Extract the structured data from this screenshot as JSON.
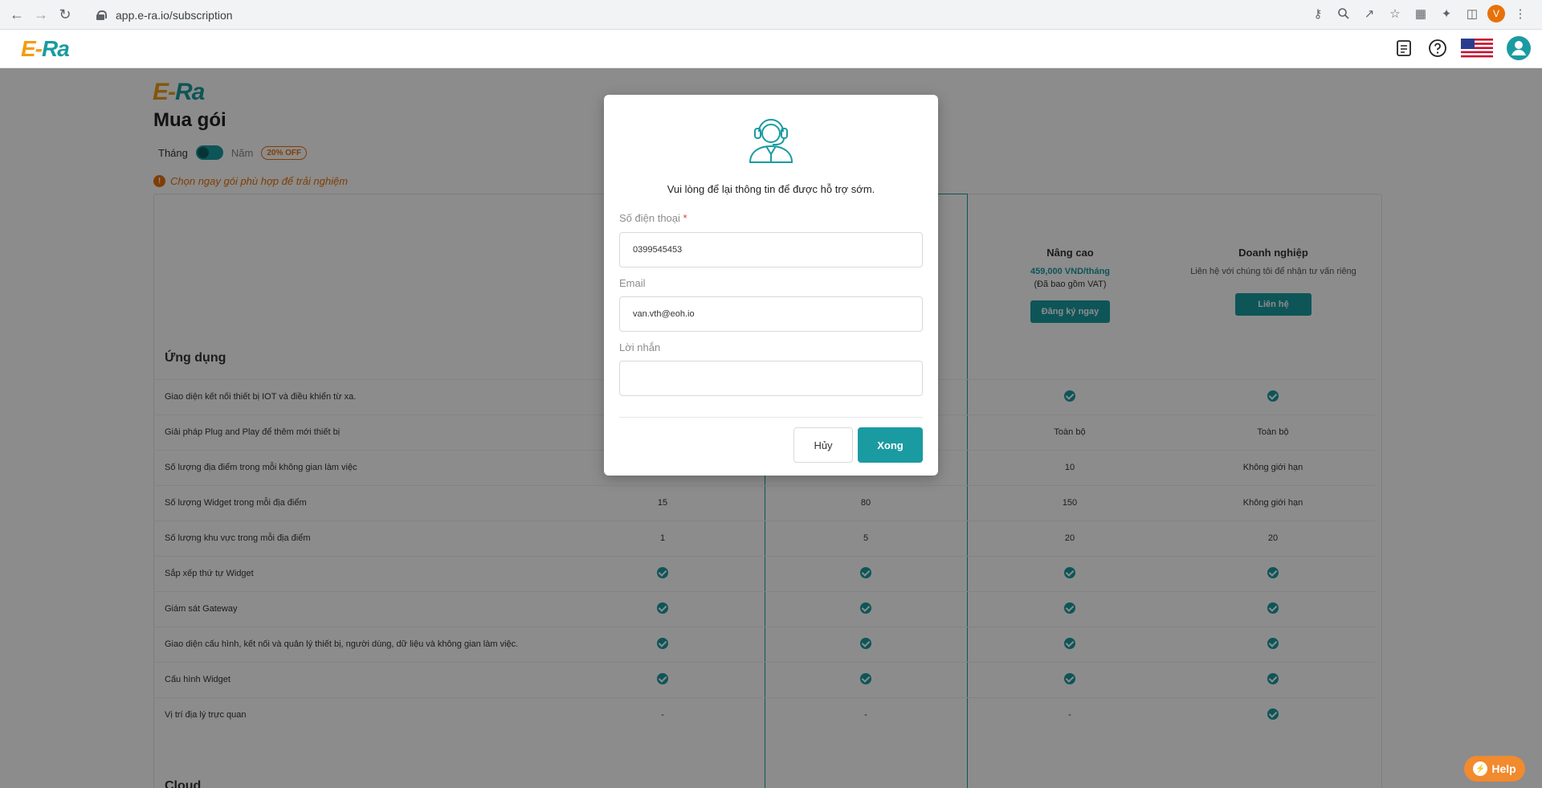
{
  "browser": {
    "url": "app.e-ra.io/subscription",
    "profile_initial": "V"
  },
  "brand": {
    "logo_prefix": "E-",
    "logo_suffix": "Ra",
    "accent": "#1a9ba1",
    "orange": "#f39c12"
  },
  "page": {
    "title": "Mua gói",
    "billing": {
      "month_label": "Tháng",
      "year_label": "Năm",
      "discount_badge": "20% OFF"
    },
    "notice": "Chọn ngay gói phù hợp để trải nghiệm",
    "plans": [
      {
        "name": "Nâng cao",
        "price": "459,000 VND/tháng",
        "note": "(Đã bao gồm VAT)",
        "button": "Đăng ký ngay"
      },
      {
        "name": "Doanh nghiệp",
        "desc": "Liên hệ với chúng tôi để nhận tư vấn riêng",
        "button": "Liên hệ"
      }
    ],
    "section_apps": "Ứng dụng",
    "section_cloud": "Cloud",
    "rows": [
      {
        "label": "Giao diện kết nối thiết bị IOT và điều khiển từ xa.",
        "c1": "",
        "c2": "",
        "c3": "check",
        "c4": "check"
      },
      {
        "label": "Giải pháp Plug and Play để thêm mới thiết bị",
        "c1": "",
        "c2": "",
        "c3": "Toàn bộ",
        "c4": "Toàn bộ"
      },
      {
        "label": "Số lượng địa điểm trong mỗi không gian làm việc",
        "c1": "",
        "c2": "",
        "c3": "10",
        "c4": "Không giới hạn"
      },
      {
        "label": "Số lượng Widget trong mỗi địa điểm",
        "c1": "15",
        "c2": "80",
        "c3": "150",
        "c4": "Không giới hạn"
      },
      {
        "label": "Số lượng khu vực trong mỗi địa điểm",
        "c1": "1",
        "c2": "5",
        "c3": "20",
        "c4": "20"
      },
      {
        "label": "Sắp xếp thứ tự Widget",
        "c1": "check",
        "c2": "check",
        "c3": "check",
        "c4": "check"
      },
      {
        "label": "Giám sát Gateway",
        "c1": "check",
        "c2": "check",
        "c3": "check",
        "c4": "check"
      },
      {
        "label": "Giao diện cấu hình, kết nối và quản lý thiết bị, người dùng, dữ liệu và không gian làm việc.",
        "c1": "check",
        "c2": "check",
        "c3": "check",
        "c4": "check"
      },
      {
        "label": "Cấu hình Widget",
        "c1": "check",
        "c2": "check",
        "c3": "check",
        "c4": "check"
      },
      {
        "label": "Vị trí địa lý trực quan",
        "c1": "-",
        "c2": "-",
        "c3": "-",
        "c4": "check"
      }
    ]
  },
  "modal": {
    "message": "Vui lòng để lại thông tin để được hỗ trợ sớm.",
    "phone_label": "Số điện thoại",
    "phone_required": "*",
    "phone_value": "0399545453",
    "email_label": "Email",
    "email_value": "van.vth@eoh.io",
    "message_label": "Lời nhắn",
    "message_value": "",
    "cancel_label": "Hủy",
    "done_label": "Xong"
  },
  "help": {
    "label": "Help"
  }
}
